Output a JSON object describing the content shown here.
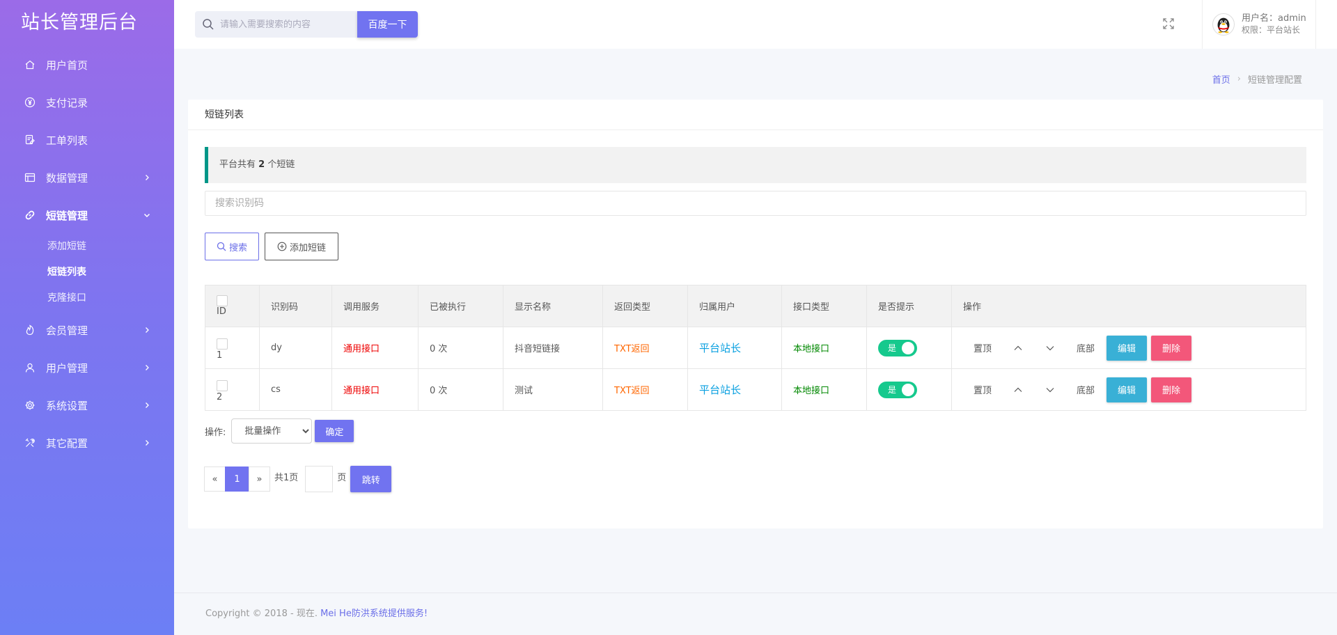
{
  "brand": "站长管理后台",
  "sidebar": {
    "items": [
      {
        "label": "用户首页",
        "icon": "home-icon"
      },
      {
        "label": "支付记录",
        "icon": "yen-icon"
      },
      {
        "label": "工单列表",
        "icon": "ticket-icon"
      },
      {
        "label": "数据管理",
        "icon": "database-icon"
      },
      {
        "label": "短链管理",
        "icon": "link-icon"
      },
      {
        "label": "会员管理",
        "icon": "fire-icon"
      },
      {
        "label": "用户管理",
        "icon": "user-icon"
      },
      {
        "label": "系统设置",
        "icon": "gear-icon"
      },
      {
        "label": "其它配置",
        "icon": "tools-icon"
      }
    ],
    "sub_items": [
      {
        "label": "添加短链"
      },
      {
        "label": "短链列表"
      },
      {
        "label": "克隆接口"
      }
    ]
  },
  "topbar": {
    "search_placeholder": "请输入需要搜索的内容",
    "search_button": "百度一下",
    "username_label": "用户名：admin",
    "role_label": "权限：平台站长"
  },
  "breadcrumb": {
    "home": "首页",
    "current": "短链管理配置"
  },
  "card": {
    "title": "短链列表",
    "notice_prefix": "平台共有 ",
    "notice_count": "2",
    "notice_suffix": " 个短链",
    "search_placeholder": "搜索识别码",
    "search_button": "搜索",
    "add_button": "添加短链"
  },
  "table": {
    "headers": [
      "ID",
      "识别码",
      "调用服务",
      "已被执行",
      "显示名称",
      "返回类型",
      "归属用户",
      "接口类型",
      "是否提示",
      "操作"
    ],
    "rows": [
      {
        "id": "1",
        "code": "dy",
        "service": "通用接口",
        "executed": "0 次",
        "name": "抖音短链接",
        "return_type": "TXT返回",
        "owner": "平台站长",
        "api_type": "本地接口",
        "tip": "是"
      },
      {
        "id": "2",
        "code": "cs",
        "service": "通用接口",
        "executed": "0 次",
        "name": "测试",
        "return_type": "TXT返回",
        "owner": "平台站长",
        "api_type": "本地接口",
        "tip": "是"
      }
    ],
    "ops": {
      "top": "置顶",
      "bottom": "底部",
      "edit": "编辑",
      "delete": "删除"
    }
  },
  "batch": {
    "label": "操作:",
    "selected": "批量操作",
    "confirm": "确定"
  },
  "pager": {
    "prev": "«",
    "current": "1",
    "next": "»",
    "total": "共1页",
    "unit": "页",
    "jump": "跳转"
  },
  "footer": {
    "text": "Copyright © 2018 - 现在. ",
    "link": "Mei He防洪系统提供服务!"
  },
  "colors": {
    "accent": "#7173f0",
    "sidebar_top": "#9b6be8",
    "sidebar_bottom": "#6c7ff5",
    "switch_on": "#16c98d",
    "edit": "#39b0d6",
    "delete": "#f3577a"
  }
}
